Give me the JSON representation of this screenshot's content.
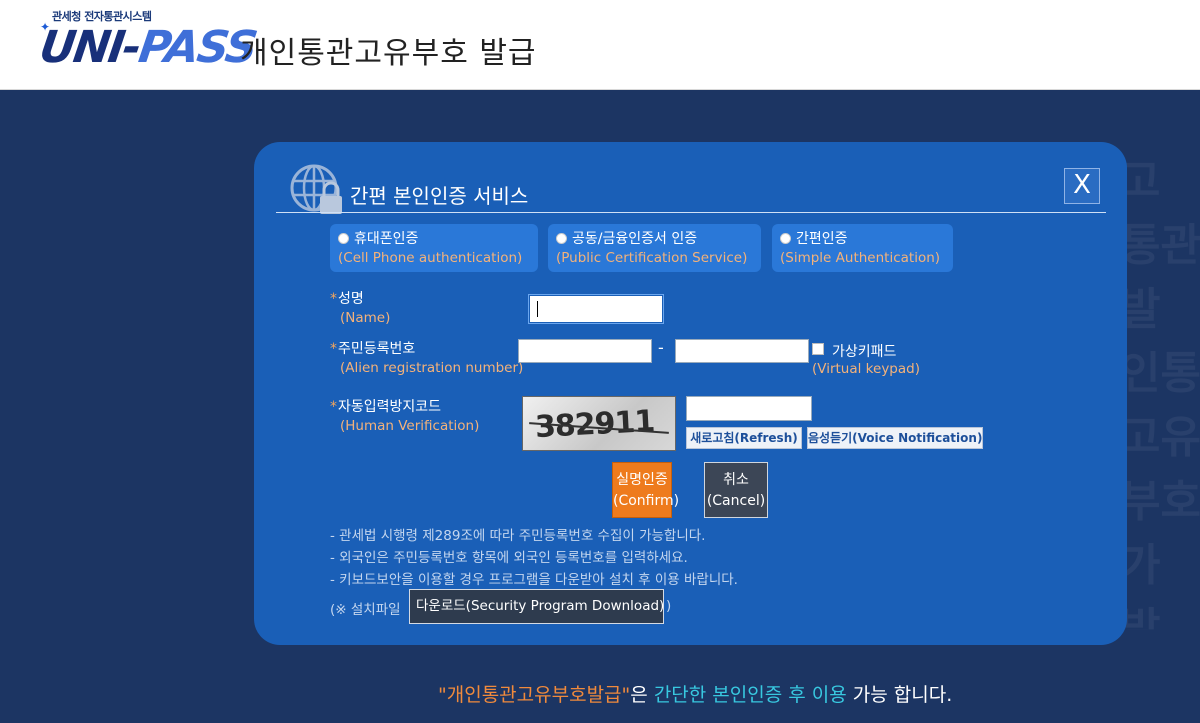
{
  "header": {
    "logo_sub": "관세청 전자통관시스템",
    "logo_main_a": "UNI-",
    "logo_main_b": "PASS",
    "title": "개인통관고유부호 발급"
  },
  "watermark": [
    "고",
    "통관",
    "발",
    "인통관",
    "고유",
    "부호",
    "가",
    "발"
  ],
  "dialog": {
    "title": "간편 본인인증 서비스",
    "close_label": "X",
    "auth_options": [
      {
        "ko": "휴대폰인증",
        "en": "(Cell Phone authentication)"
      },
      {
        "ko": "공동/금융인증서 인증",
        "en": "(Public Certification Service)"
      },
      {
        "ko": "간편인증",
        "en": "(Simple Authentication)"
      }
    ],
    "fields": {
      "name": {
        "ko": "성명",
        "en": "(Name)",
        "value": ""
      },
      "reg": {
        "ko": "주민등록번호",
        "en": "(Alien registration number)",
        "value1": "",
        "value2": "",
        "separator": "-"
      },
      "virtual_keypad": {
        "ko": "가상키패드",
        "en": "(Virtual keypad)"
      },
      "captcha": {
        "ko": "자동입력방지코드",
        "en": "(Human Verification)",
        "image_text": "382911",
        "value": ""
      }
    },
    "required_mark": "*",
    "refresh_label": "새로고침(Refresh)",
    "voice_label": "음성듣기(Voice Notification)",
    "confirm": {
      "ko": "실명인증",
      "en": "(Confirm)"
    },
    "cancel": {
      "ko": "취소",
      "en": "(Cancel)"
    },
    "notices": [
      "- 관세법 시행령 제289조에 따라 주민등록번호 수집이 가능합니다.",
      "- 외국인은 주민등록번호 항목에 외국인 등록번호를 입력하세요.",
      "- 키보드보안을 이용할 경우 프로그램을 다운받아 설치 후 이용 바랍니다."
    ],
    "download_prefix": "(※ 설치파일",
    "download_label": "다운로드(Security Program Download)",
    "download_suffix": ")"
  },
  "footer": {
    "part1": "\"개인통관고유부호발급\"",
    "part2": "은 ",
    "part3": "간단한 본인인증 후 이용",
    "part4": " 가능 합니다."
  },
  "colors": {
    "page_bg": "#1c3563",
    "dialog_bg": "#1a5fb7",
    "option_bg": "#2a78d8",
    "accent_orange": "#ee7b1d",
    "english_label": "#f4b27a",
    "footer_cyan": "#38c8e0"
  }
}
